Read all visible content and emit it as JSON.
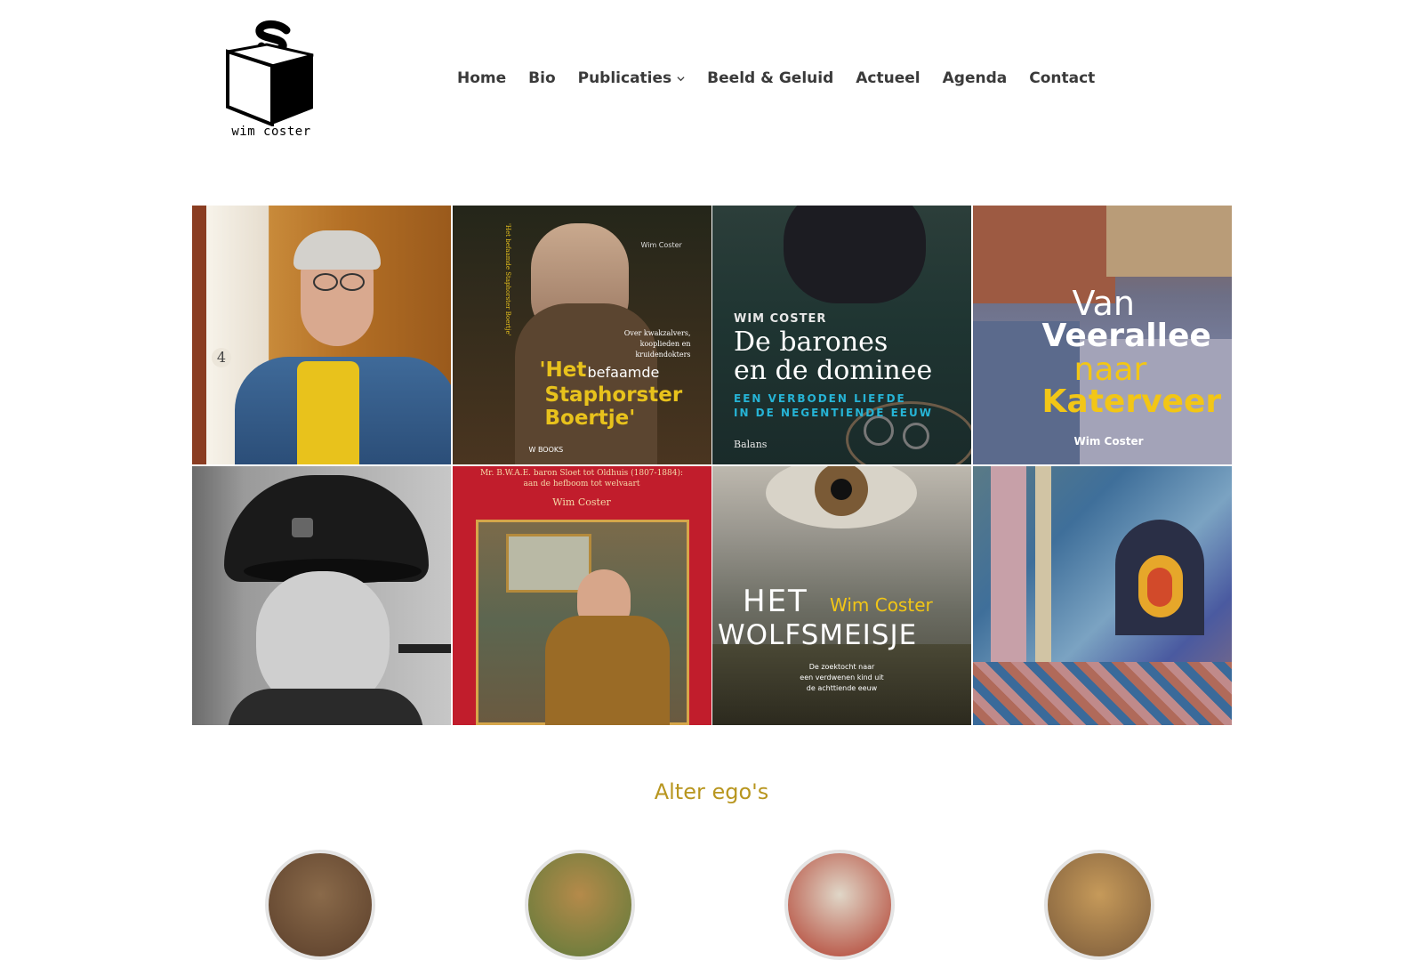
{
  "logo": {
    "text": "wim coster",
    "icon": "cube-logo-icon"
  },
  "nav": {
    "items": [
      {
        "label": "Home"
      },
      {
        "label": "Bio"
      },
      {
        "label": "Publicaties",
        "has_dropdown": true,
        "icon": "chevron-down-icon"
      },
      {
        "label": "Beeld & Geluid"
      },
      {
        "label": "Actueel"
      },
      {
        "label": "Agenda"
      },
      {
        "label": "Contact"
      }
    ]
  },
  "gallery": {
    "tiles": [
      {
        "kind": "author-portrait",
        "door_number": "4"
      },
      {
        "kind": "book-cover",
        "author": "Wim Coster",
        "spine": "'Het befaamde Staphorster Boertje'",
        "subtitle": "Over kwakzalvers, kooplieden en kruidendokters",
        "title_1": "'Het",
        "title_2": "befaamde",
        "title_3": "Staphorster",
        "title_4": "Boertje'",
        "publisher": "W BOOKS"
      },
      {
        "kind": "book-cover",
        "author": "WIM COSTER",
        "title_1": "De barones",
        "title_2": "en de dominee",
        "subtitle_1": "EEN VERBODEN LIEFDE",
        "subtitle_2": "IN DE NEGENTIENDE EEUW",
        "publisher": "Balans"
      },
      {
        "kind": "book-cover",
        "title_1": "Van",
        "title_2": "Veerallee",
        "title_3": "naar",
        "title_4": "Katerveer",
        "author": "Wim Coster"
      },
      {
        "kind": "childhood-photo"
      },
      {
        "kind": "book-cover",
        "header_1": "Mr. B.W.A.E. baron Sloet tot Oldhuis (1807-1884):",
        "header_2": "aan de hefboom tot welvaart",
        "author": "Wim Coster"
      },
      {
        "kind": "book-cover",
        "title_1": "HET",
        "title_2": "WOLFSMEISJE",
        "author": "Wim Coster",
        "subtitle_1": "De zoektocht naar",
        "subtitle_2": "een verdwenen kind uit",
        "subtitle_3": "de achttiende eeuw"
      },
      {
        "kind": "embroidery"
      }
    ]
  },
  "section": {
    "title": "Alter ego's"
  },
  "colors": {
    "accent": "#b8961f",
    "nav_text": "#3a3a3a"
  }
}
